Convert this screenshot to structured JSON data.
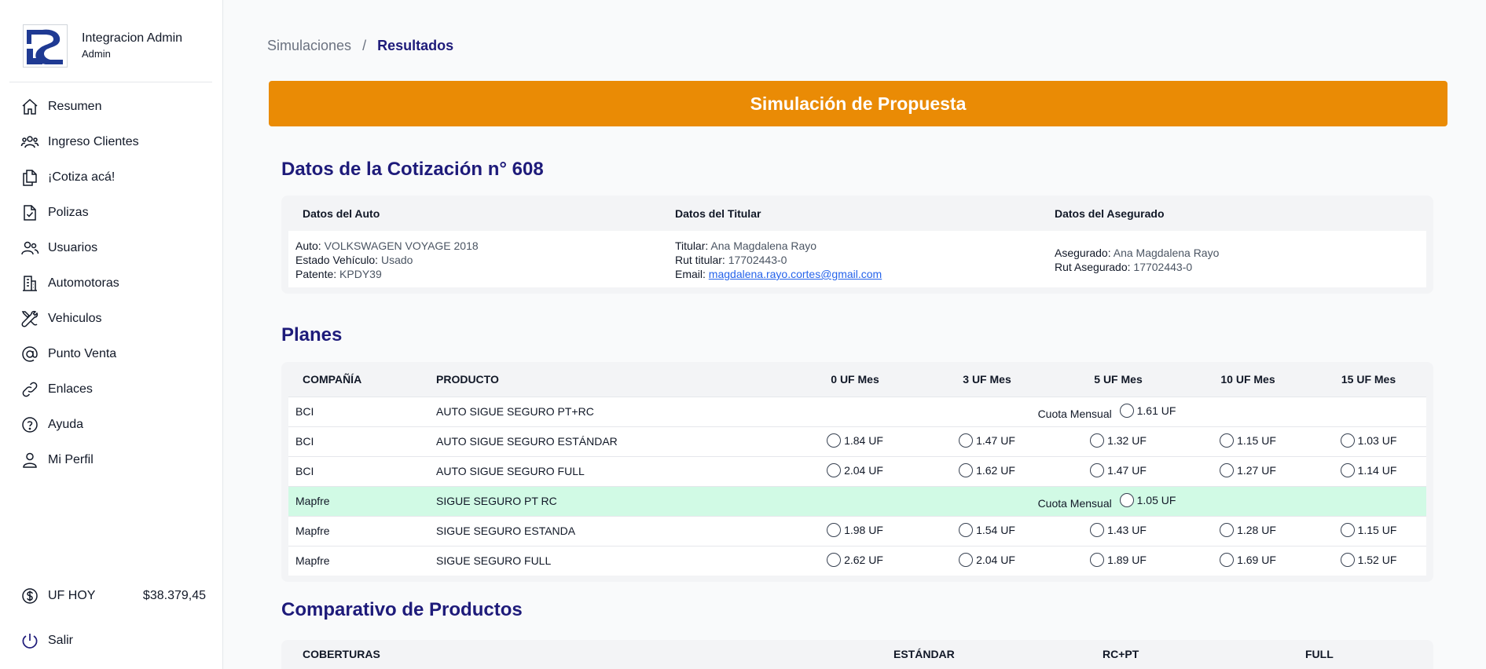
{
  "sidebar": {
    "user_name": "Integracion Admin",
    "user_role": "Admin",
    "items": [
      {
        "label": "Resumen",
        "icon": "home-icon"
      },
      {
        "label": "Ingreso Clientes",
        "icon": "users-group-icon"
      },
      {
        "label": "¡Cotiza acá!",
        "icon": "documents-icon"
      },
      {
        "label": "Polizas",
        "icon": "document-check-icon"
      },
      {
        "label": "Usuarios",
        "icon": "users-icon"
      },
      {
        "label": "Automotoras",
        "icon": "building-icon"
      },
      {
        "label": "Vehiculos",
        "icon": "wrench-screwdriver-icon"
      },
      {
        "label": "Punto Venta",
        "icon": "at-sign-icon"
      },
      {
        "label": "Enlaces",
        "icon": "link-icon"
      },
      {
        "label": "Ayuda",
        "icon": "question-circle-icon"
      },
      {
        "label": "Mi Perfil",
        "icon": "user-icon"
      }
    ],
    "uf_label": "UF HOY",
    "uf_value": "$38.379,45",
    "logout_label": "Salir"
  },
  "breadcrumb": {
    "parent": "Simulaciones",
    "separator": "/",
    "current": "Resultados"
  },
  "banner": {
    "title": "Simulación de Propuesta"
  },
  "quote": {
    "title": "Datos de la Cotización n° 608",
    "headers": [
      "Datos del Auto",
      "Datos del Titular",
      "Datos del Asegurado"
    ],
    "auto": [
      {
        "k": "Auto:",
        "v": "VOLKSWAGEN VOYAGE 2018"
      },
      {
        "k": "Estado Vehículo:",
        "v": "Usado"
      },
      {
        "k": "Patente:",
        "v": "KPDY39"
      }
    ],
    "titular": [
      {
        "k": "Titular:",
        "v": "Ana Magdalena Rayo"
      },
      {
        "k": "Rut titular:",
        "v": "17702443-0"
      },
      {
        "k": "Email:",
        "v": "magdalena.rayo.cortes@gmail.com"
      }
    ],
    "asegurado": [
      {
        "k": "Asegurado:",
        "v": "Ana Magdalena Rayo"
      },
      {
        "k": "Rut Asegurado:",
        "v": "17702443-0"
      }
    ]
  },
  "plans": {
    "title": "Planes",
    "headers": [
      "COMPAÑÍA",
      "PRODUCTO",
      "0 UF Mes",
      "3 UF Mes",
      "5 UF Mes",
      "10 UF Mes",
      "15 UF Mes"
    ],
    "cuota_label": "Cuota Mensual",
    "rows": [
      {
        "company": "BCI",
        "product": "AUTO SIGUE SEGURO PT+RC",
        "cuota": "1.61 UF"
      },
      {
        "company": "BCI",
        "product": "AUTO SIGUE SEGURO ESTÁNDAR",
        "values": [
          "1.84 UF",
          "1.47 UF",
          "1.32 UF",
          "1.15 UF",
          "1.03 UF"
        ]
      },
      {
        "company": "BCI",
        "product": "AUTO SIGUE SEGURO FULL",
        "values": [
          "2.04 UF",
          "1.62 UF",
          "1.47 UF",
          "1.27 UF",
          "1.14 UF"
        ]
      },
      {
        "company": "Mapfre",
        "product": "SIGUE SEGURO PT RC",
        "cuota": "1.05 UF",
        "highlight": true
      },
      {
        "company": "Mapfre",
        "product": "SIGUE SEGURO ESTANDA",
        "values": [
          "1.98 UF",
          "1.54 UF",
          "1.43 UF",
          "1.28 UF",
          "1.15 UF"
        ]
      },
      {
        "company": "Mapfre",
        "product": "SIGUE SEGURO FULL",
        "values": [
          "2.62 UF",
          "2.04 UF",
          "1.89 UF",
          "1.69 UF",
          "1.52 UF"
        ]
      }
    ]
  },
  "comparison": {
    "title": "Comparativo de Productos",
    "headers": [
      "COBERTURAS",
      "ESTÁNDAR",
      "RC+PT",
      "FULL"
    ]
  },
  "colors": {
    "accent": "#ea8b05",
    "title": "#1e1b7a",
    "highlight_row": "#d1fae5",
    "link": "#2563eb"
  }
}
